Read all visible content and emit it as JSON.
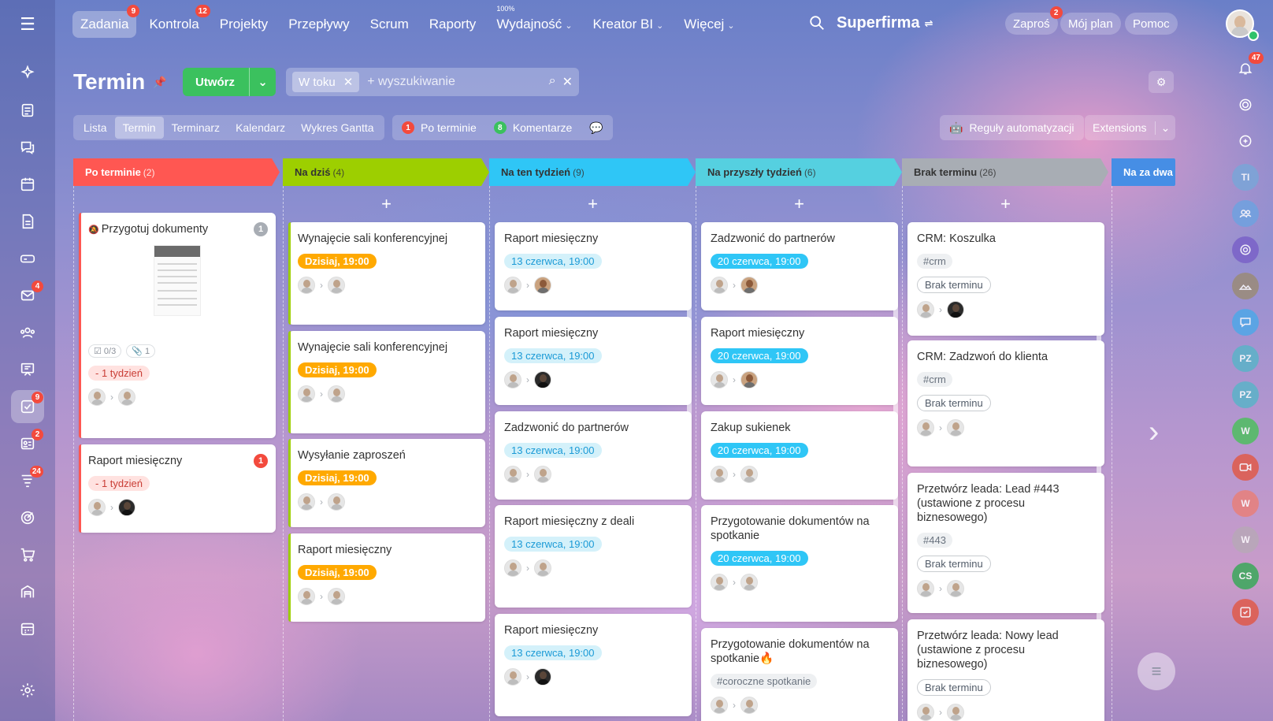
{
  "nav": {
    "items": [
      {
        "label": "Zadania",
        "badge": "9",
        "active": true
      },
      {
        "label": "Kontrola",
        "badge": "12"
      },
      {
        "label": "Projekty"
      },
      {
        "label": "Przepływy"
      },
      {
        "label": "Scrum"
      },
      {
        "label": "Raporty"
      },
      {
        "label": "Wydajność",
        "sup": "100%",
        "dropdown": true
      },
      {
        "label": "Kreator BI",
        "dropdown": true
      },
      {
        "label": "Więcej",
        "dropdown": true
      }
    ],
    "brand": "Superfirma",
    "invite": "Zaproś",
    "invite_badge": "2",
    "myplan": "Mój plan",
    "help": "Pomoc"
  },
  "left_rail": {
    "icons": [
      {
        "name": "sparkle-icon"
      },
      {
        "name": "feed-icon"
      },
      {
        "name": "chat-icon"
      },
      {
        "name": "calendar-icon"
      },
      {
        "name": "document-icon"
      },
      {
        "name": "drive-icon"
      },
      {
        "name": "mail-icon",
        "badge": "4"
      },
      {
        "name": "contacts-icon"
      },
      {
        "name": "board-icon"
      },
      {
        "name": "tasks-icon",
        "badge": "9",
        "active": true
      },
      {
        "name": "crm-icon",
        "badge": "2"
      },
      {
        "name": "funnel-icon",
        "badge": "24"
      },
      {
        "name": "target-icon"
      },
      {
        "name": "cart-icon"
      },
      {
        "name": "warehouse-icon"
      },
      {
        "name": "schedule-icon"
      }
    ]
  },
  "header": {
    "title": "Termin",
    "create_label": "Utwórz",
    "filter_chip": "W toku",
    "search_placeholder": "+ wyszukiwanie"
  },
  "view_tabs": [
    "Lista",
    "Termin",
    "Terminarz",
    "Kalendarz",
    "Wykres Gantta"
  ],
  "counters": {
    "overdue_count": "1",
    "overdue_label": "Po terminie",
    "comments_count": "8",
    "comments_label": "Komentarze"
  },
  "automation_label": "Reguły automatyzacji",
  "extensions_label": "Extensions",
  "colors": {
    "overdue": "#ff5752",
    "today": "#9dcf00",
    "this_week": "#2fc6f6",
    "next_week": "#55d0e0",
    "no_deadline": "#a8adb4",
    "two_weeks": "#468ee5",
    "green_button": "#3bc15e"
  },
  "columns": [
    {
      "title": "Po terminie",
      "count": "(2)"
    },
    {
      "title": "Na dziś",
      "count": "(4)"
    },
    {
      "title": "Na ten tydzień",
      "count": "(9)"
    },
    {
      "title": "Na przyszły tydzień",
      "count": "(6)"
    },
    {
      "title": "Brak terminu",
      "count": "(26)"
    },
    {
      "title": "Na za dwa",
      "count": ""
    }
  ],
  "cards": {
    "overdue": [
      {
        "title": "Przygotuj dokumenty",
        "badge": "1",
        "checklist": "0/3",
        "files": "1",
        "deadline": "- 1 tydzień"
      },
      {
        "title": "Raport miesięczny",
        "badge": "1",
        "deadline": "- 1 tydzień"
      }
    ],
    "today": [
      {
        "title": "Wynajęcie sali konferencyjnej",
        "deadline": "Dzisiaj, 19:00"
      },
      {
        "title": "Wynajęcie sali konferencyjnej",
        "deadline": "Dzisiaj, 19:00"
      },
      {
        "title": "Wysyłanie zaproszeń",
        "deadline": "Dzisiaj, 19:00"
      },
      {
        "title": "Raport miesięczny",
        "deadline": "Dzisiaj, 19:00"
      }
    ],
    "this_week": [
      {
        "title": "Raport miesięczny",
        "deadline": "13 czerwca, 19:00"
      },
      {
        "title": "Raport miesięczny",
        "deadline": "13 czerwca, 19:00"
      },
      {
        "title": "Zadzwonić do partnerów",
        "deadline": "13 czerwca, 19:00"
      },
      {
        "title": "Raport miesięczny z deali",
        "deadline": "13 czerwca, 19:00"
      },
      {
        "title": "Raport miesięczny",
        "deadline": "13 czerwca, 19:00"
      }
    ],
    "next_week": [
      {
        "title": "Zadzwonić do partnerów",
        "deadline": "20 czerwca, 19:00"
      },
      {
        "title": "Raport miesięczny",
        "deadline": "20 czerwca, 19:00"
      },
      {
        "title": "Zakup sukienek",
        "deadline": "20 czerwca, 19:00"
      },
      {
        "title": "Przygotowanie dokumentów na spotkanie",
        "deadline": "20 czerwca, 19:00"
      },
      {
        "title": "Przygotowanie dokumentów na spotkanie",
        "fire": "🔥",
        "tag": "#coroczne spotkanie"
      }
    ],
    "no_deadline": [
      {
        "title": "CRM: Koszulka",
        "tag": "#crm",
        "deadline": "Brak terminu"
      },
      {
        "title": "CRM: Zadzwoń do klienta",
        "tag": "#crm",
        "deadline": "Brak terminu"
      },
      {
        "title": "Przetwórz leada: Lead #443 (ustawione z procesu biznesowego)",
        "tag": "#443",
        "deadline": "Brak terminu"
      },
      {
        "title": "Przetwórz leada: Nowy lead (ustawione z procesu biznesowego)",
        "deadline": "Brak terminu"
      }
    ]
  },
  "right_rail": {
    "bell_badge": "47",
    "items": [
      {
        "name": "bell-icon"
      },
      {
        "name": "copilot-icon"
      },
      {
        "name": "support-icon"
      },
      {
        "initials": "TI",
        "color": "#7aa6d8"
      },
      {
        "name": "group-icon",
        "color": "#6fa2e0"
      },
      {
        "name": "channel-icon",
        "color": "#7a62c8"
      },
      {
        "name": "landscape-avatar",
        "color": "#9a8b78"
      },
      {
        "name": "chat-bubble-icon",
        "color": "#4fa8e8"
      },
      {
        "initials": "PZ",
        "color": "#5bb3c8"
      },
      {
        "initials": "PZ",
        "color": "#5bb3c8"
      },
      {
        "initials": "W",
        "color": "#4fbf60"
      },
      {
        "name": "video-icon",
        "color": "#e05a4a"
      },
      {
        "initials": "W",
        "color": "#e8807a"
      },
      {
        "initials": "W",
        "color": "#b8a8b8"
      },
      {
        "initials": "CS",
        "color": "#3aa85a"
      },
      {
        "name": "tasks-small-icon",
        "color": "#e05a4a"
      }
    ]
  }
}
